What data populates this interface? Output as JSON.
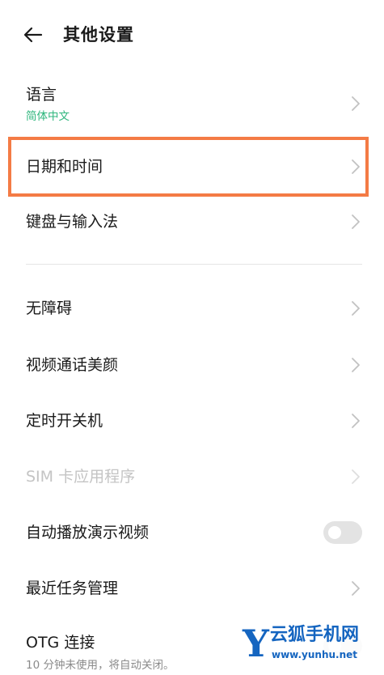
{
  "header": {
    "title": "其他设置",
    "back_icon": "arrow-left-icon"
  },
  "colors": {
    "accent_green": "#2fb67d",
    "highlight_orange": "#f47b45",
    "disabled_text": "#c4c4c4",
    "watermark_blue": "#1565c0"
  },
  "settings": {
    "items": [
      {
        "label": "语言",
        "subtitle": "简体中文",
        "control": "chevron",
        "enabled": true
      },
      {
        "label": "日期和时间",
        "control": "chevron",
        "enabled": true,
        "highlighted": true
      },
      {
        "label": "键盘与输入法",
        "control": "chevron",
        "enabled": true
      },
      {
        "label": "无障碍",
        "control": "chevron",
        "enabled": true
      },
      {
        "label": "视频通话美颜",
        "control": "chevron",
        "enabled": true
      },
      {
        "label": "定时开关机",
        "control": "chevron",
        "enabled": true
      },
      {
        "label": "SIM 卡应用程序",
        "control": "chevron",
        "enabled": false
      },
      {
        "label": "自动播放演示视频",
        "control": "toggle",
        "toggle_on": false,
        "enabled": true
      },
      {
        "label": "最近任务管理",
        "control": "chevron",
        "enabled": true
      },
      {
        "label": "OTG 连接",
        "subtitle": "10 分钟未使用，将自动关闭。",
        "control": "toggle",
        "enabled": true
      }
    ]
  },
  "watermark": {
    "logo_letter": "Y",
    "name": "云狐手机网",
    "url": "www.yunhu.net"
  }
}
